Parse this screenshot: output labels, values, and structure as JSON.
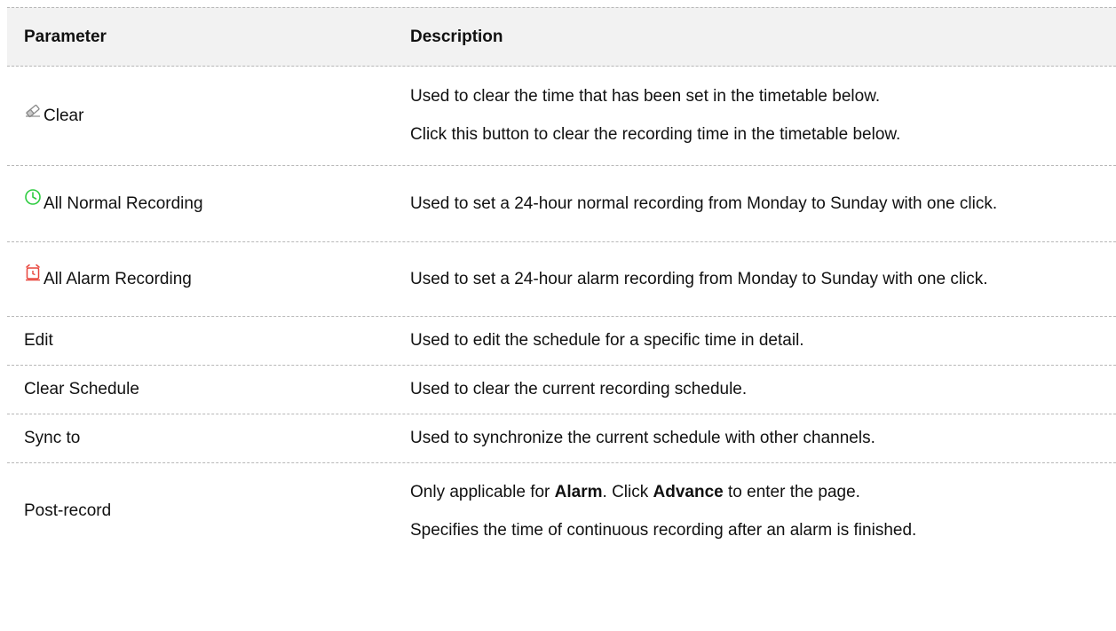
{
  "headers": {
    "parameter": "Parameter",
    "description": "Description"
  },
  "rows": [
    {
      "param": "Clear",
      "icon": "eraser-icon",
      "desc": [
        "Used to clear the time that has been set in the timetable below.",
        "Click this button to clear the recording time in the timetable below."
      ]
    },
    {
      "param": "All Normal Recording",
      "icon": "clock-icon",
      "icon_color": "#2ecc40",
      "desc": [
        "Used to set a 24-hour normal recording from Monday to Sunday with one click."
      ]
    },
    {
      "param": "All Alarm Recording",
      "icon": "alarm-clock-icon",
      "icon_color": "#e8453c",
      "desc": [
        "Used to set a 24-hour alarm recording from Monday to Sunday with one click."
      ]
    },
    {
      "param": "Edit",
      "desc": [
        "Used to edit the schedule for a specific time in detail."
      ]
    },
    {
      "param": "Clear Schedule",
      "desc": [
        "Used to clear the current recording schedule."
      ]
    },
    {
      "param": "Sync to",
      "desc": [
        "Used to synchronize the current schedule with other channels."
      ]
    },
    {
      "param": "Post-record",
      "desc_parts": {
        "a": "Only applicable for ",
        "b": "Alarm",
        "c": ". Click ",
        "d": "Advance",
        "e": " to enter the page."
      },
      "desc": [
        "Specifies the time of continuous recording after an alarm is finished."
      ]
    }
  ]
}
